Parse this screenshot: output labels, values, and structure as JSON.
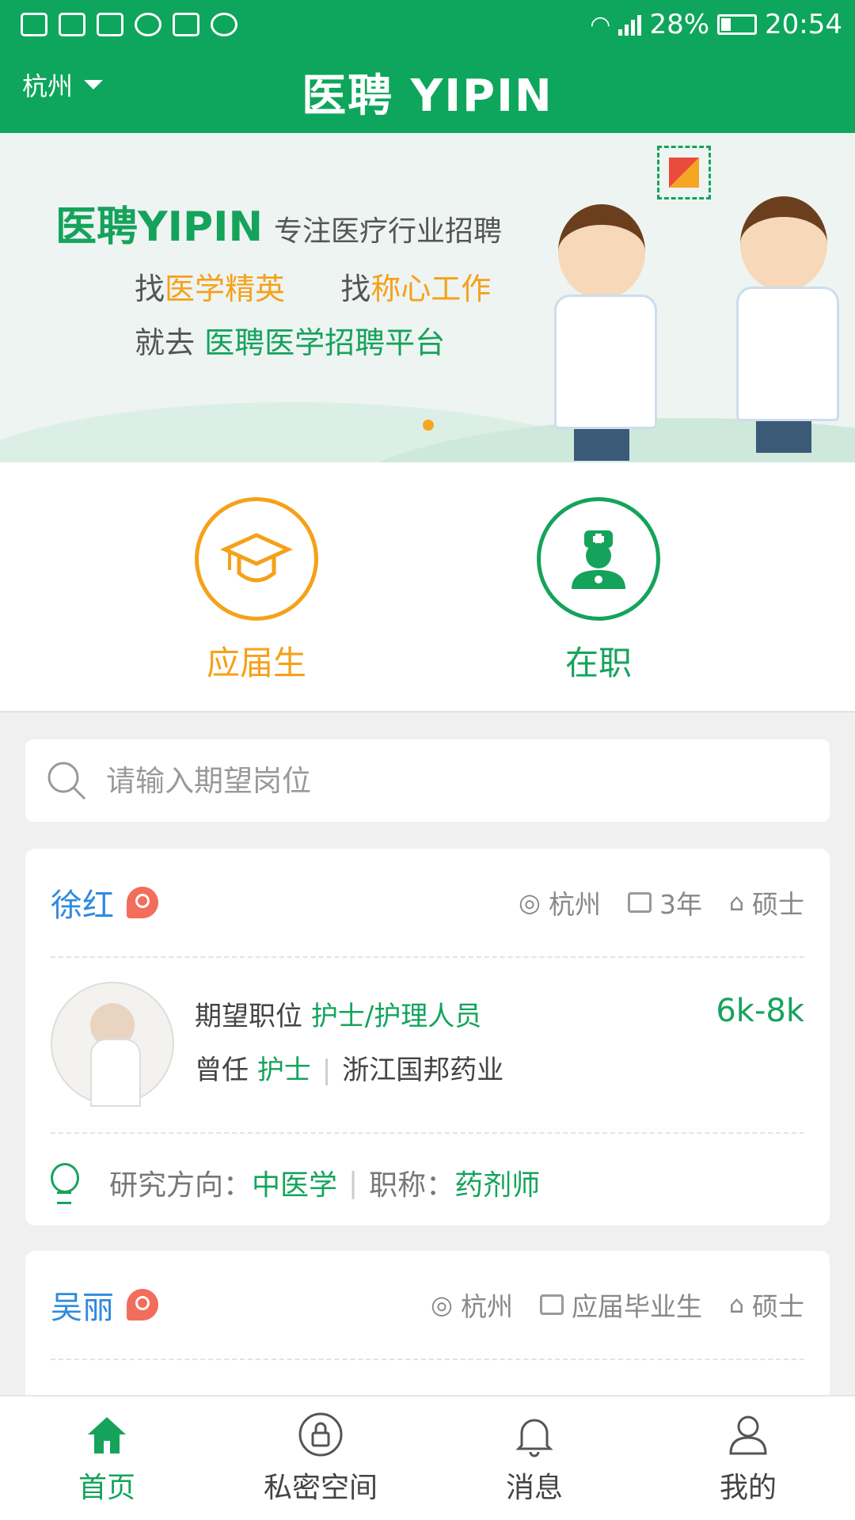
{
  "status_bar": {
    "battery": "28%",
    "time": "20:54"
  },
  "header": {
    "city": "杭州",
    "logo": "医聘 YIPIN"
  },
  "banner": {
    "brand": "医聘YIPIN",
    "slogan": "专注医疗行业招聘",
    "line1_a": "找",
    "line1_b": "医学精英",
    "line1_c": "找",
    "line1_d": "称心工作",
    "line2_a": "就去",
    "line2_b": "医聘医学招聘平台"
  },
  "categories": [
    {
      "label": "应届生",
      "icon": "graduation-cap-icon",
      "color": "#f5a11a"
    },
    {
      "label": "在职",
      "icon": "doctor-icon",
      "color": "#15a35c"
    }
  ],
  "search": {
    "placeholder": "请输入期望岗位"
  },
  "candidates": [
    {
      "name": "徐红",
      "gender_icon": "female-icon",
      "city": "杭州",
      "experience": "3年",
      "degree": "硕士",
      "expect_label": "期望职位",
      "expect_position": "护士/护理人员",
      "salary": "6k-8k",
      "former_label": "曾任",
      "former_title": "护士",
      "former_company": "浙江国邦药业",
      "research_label": "研究方向：",
      "research": "中医学",
      "title_label": "职称：",
      "title": "药剂师"
    },
    {
      "name": "吴丽",
      "gender_icon": "female-icon",
      "city": "杭州",
      "experience": "应届毕业生",
      "degree": "硕士"
    }
  ],
  "nav": [
    {
      "label": "首页",
      "icon": "home-icon",
      "active": true
    },
    {
      "label": "私密空间",
      "icon": "lock-icon",
      "active": false
    },
    {
      "label": "消息",
      "icon": "bell-icon",
      "active": false
    },
    {
      "label": "我的",
      "icon": "user-icon",
      "active": false
    }
  ],
  "colors": {
    "brand_green": "#0ea65c",
    "accent_orange": "#f5a11a",
    "name_blue": "#2f8ae0"
  }
}
